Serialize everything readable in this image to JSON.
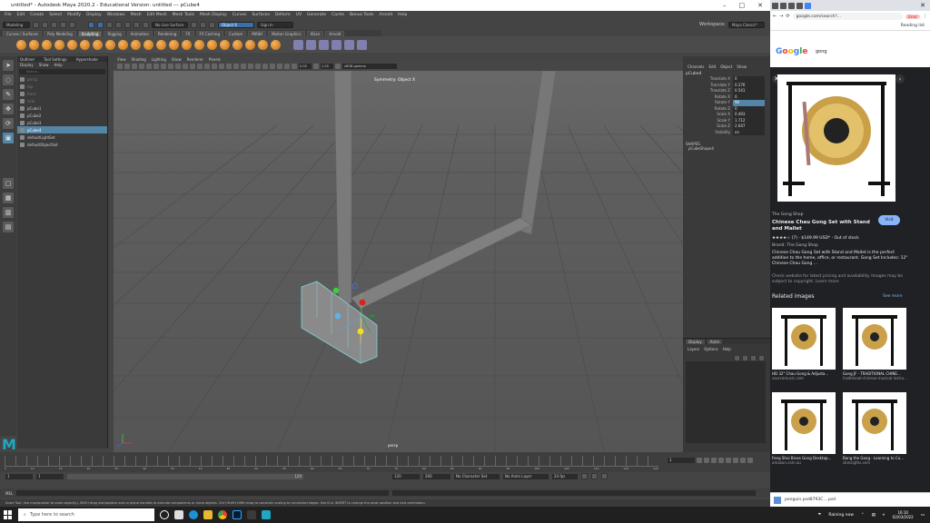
{
  "maya": {
    "window_title": "untitled* - Autodesk Maya 2020.2 - Educational Version: untitled --- pCube4",
    "menus": [
      "File",
      "Edit",
      "Create",
      "Select",
      "Modify",
      "Display",
      "Windows",
      "Mesh",
      "Edit Mesh",
      "Mesh Tools",
      "Mesh Display",
      "Curves",
      "Surfaces",
      "Deform",
      "UV",
      "Generate",
      "Cache",
      "Bonus Tools",
      "Arnold",
      "Help"
    ],
    "workspace_label": "Workspace:",
    "workspace_value": "Maya Classic*",
    "mode_menu": "Modeling",
    "no_live_surface": "No Live Surface",
    "symmetry_field": "Object X",
    "sign_in": "Sign In",
    "shelf_tabs": [
      "Curves / Surfaces",
      "Poly Modeling",
      "Sculpting",
      "Rigging",
      "Animation",
      "Rendering",
      "FX",
      "FX Caching",
      "Custom",
      "MASH",
      "Motion Graphics",
      "XGen",
      "Arnold"
    ],
    "active_shelf_tab": "Sculpting",
    "outliner": {
      "tabs": [
        "Outliner",
        "Tool Settings",
        "Hypershade"
      ],
      "menus": [
        "Display",
        "Show",
        "Help"
      ],
      "search_placeholder": "Search...",
      "items": [
        {
          "label": "persp",
          "dim": true
        },
        {
          "label": "top",
          "dim": true
        },
        {
          "label": "front",
          "dim": true
        },
        {
          "label": "side",
          "dim": true
        },
        {
          "label": "pCube1",
          "dim": false
        },
        {
          "label": "pCube2",
          "dim": false
        },
        {
          "label": "pCube3",
          "dim": false
        },
        {
          "label": "pCube4",
          "dim": false,
          "selected": true
        },
        {
          "label": "defaultLightSet",
          "dim": false
        },
        {
          "label": "defaultObjectSet",
          "dim": false
        }
      ]
    },
    "viewport": {
      "menus": [
        "View",
        "Shading",
        "Lighting",
        "Show",
        "Renderer",
        "Panels"
      ],
      "near_value": "0.00",
      "far_value": "1.00",
      "color_space": "sRGB gamma",
      "symmetry_label": "Symmetry: Object X",
      "camera_label": "persp"
    },
    "channel_box": {
      "menus": [
        "Channels",
        "Edit",
        "Object",
        "Show"
      ],
      "object": "pCube4",
      "channels": [
        {
          "name": "Translate X",
          "value": "0"
        },
        {
          "name": "Translate Y",
          "value": "0.276"
        },
        {
          "name": "Translate Z",
          "value": "0.541"
        },
        {
          "name": "Rotate X",
          "value": "0"
        },
        {
          "name": "Rotate Y",
          "value": "90",
          "highlight": true
        },
        {
          "name": "Rotate Z",
          "value": "0"
        },
        {
          "name": "Scale X",
          "value": "0.493"
        },
        {
          "name": "Scale Y",
          "value": "1.712"
        },
        {
          "name": "Scale Z",
          "value": "2.647"
        },
        {
          "name": "Visibility",
          "value": "on"
        }
      ],
      "shapes_header": "SHAPES",
      "shape_name": "pCubeShape4"
    },
    "layers": {
      "tabs": [
        "Display",
        "Anim"
      ],
      "menus": [
        "Layers",
        "Options",
        "Help"
      ]
    },
    "timeline": {
      "tick_labels": [
        "5",
        "10",
        "15",
        "20",
        "25",
        "30",
        "35",
        "40",
        "45",
        "50",
        "55",
        "60",
        "65",
        "70",
        "75",
        "80",
        "85",
        "90",
        "95",
        "100",
        "105",
        "110",
        "115",
        "120"
      ],
      "current_frame": "1"
    },
    "range": {
      "start": "1",
      "start_inner": "1",
      "end_inner": "120",
      "end": "120",
      "end_max": "200",
      "character_set": "No Character Set",
      "anim_layer": "No Anim Layer",
      "fps": "24 fps"
    },
    "mel_label": "MEL",
    "help_line": "Scale Tool: Use manipulator to scale object(s). Shift+drag manipulator axis or plane handles to extrude components or clone objects. Ctrl+Shift+LMB+drag to constrain scaling to connected edges. Use D or INSERT to change the pivot position and axis orientation."
  },
  "browser": {
    "url": "google.com/search?...",
    "bookmark": "Reading list",
    "profile": "Error",
    "query": "gong",
    "source": "The Gong Shop",
    "product_title": "Chinese Chau Gong Set with Stand and Mallet",
    "visit": "Visit",
    "price": "★★★★☆ (7) · $149.99 USD* · Out of stock",
    "brand": "Brand: The Gong Shop",
    "description": "Chinese Chau Gong Set with Stand and Mallet is the perfect addition to the home, office, or restaurant. Gong Set Includes: 12\" Chinese Chau Gong ...",
    "notice": "Check website for latest pricing and availability. Images may be subject to copyright. Learn more",
    "related_header": "Related images",
    "see_more": "See more",
    "thumbs": [
      {
        "title": "HD 32\" Chau Gong & Adjusta...",
        "src": "sourcemusic.com"
      },
      {
        "title": "Gong JF - TRADITIONAL CHINE...",
        "src": "traditional-chinese-musical-instru..."
      },
      {
        "title": "Feng Shui Brass Gong Desktop...",
        "src": "amazon.com.au"
      },
      {
        "title": "Bang the Gong - Learning to Co...",
        "src": "sbinsights.com"
      }
    ],
    "show_all": "Show all",
    "download_file": "penguin.psd8793C....psd"
  },
  "taskbar": {
    "search_placeholder": "Type here to search",
    "weather": "Raining now",
    "time": "16:10",
    "date": "02/03/2022"
  }
}
